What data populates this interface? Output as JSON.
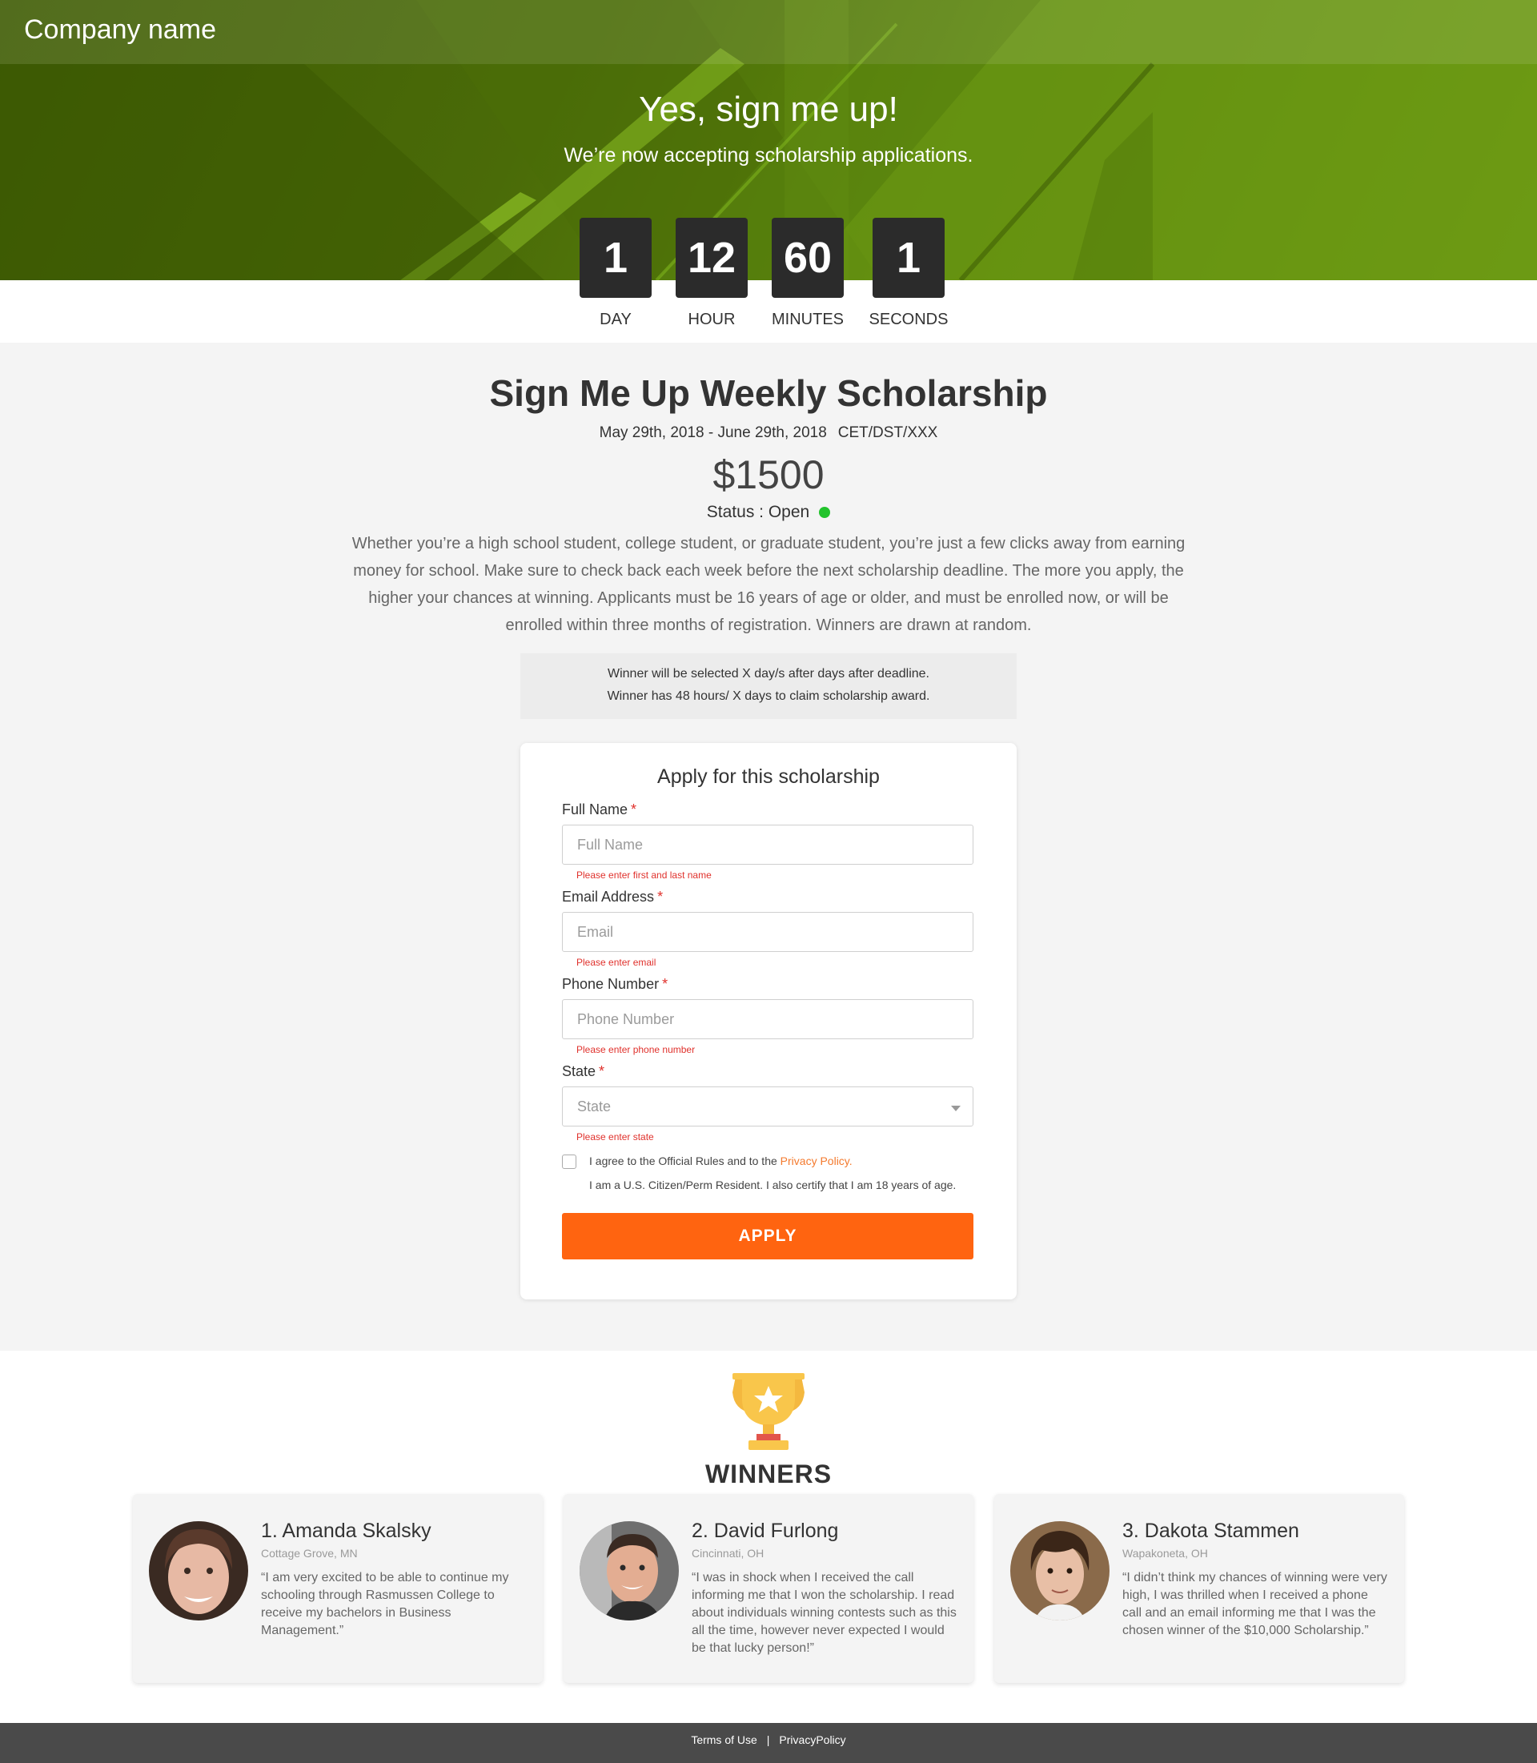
{
  "header": {
    "company_name": "Company name",
    "title": "Yes, sign me up!",
    "subtitle": "We’re now accepting scholarship applications."
  },
  "countdown": [
    {
      "value": "1",
      "label": "DAY"
    },
    {
      "value": "12",
      "label": "HOUR"
    },
    {
      "value": "60",
      "label": "MINUTES"
    },
    {
      "value": "1",
      "label": "SECONDS"
    }
  ],
  "scholarship": {
    "title": "Sign Me Up Weekly Scholarship",
    "dates": "May 29th, 2018 - June 29th, 2018",
    "timezone": "CET/DST/XXX",
    "amount": "$1500",
    "status": "Status : Open",
    "status_color": "#22c32c",
    "description": "Whether you’re a high school student, college student, or graduate student, you’re just a few clicks away from earning money for school. Make sure to check back each week before the next scholarship deadline. The more you apply, the higher your chances at winning. Applicants must be 16 years of age or older, and must be enrolled now, or will be enrolled within three months of registration. Winners are drawn at random.",
    "note_line1": "Winner will be selected X day/s after days after deadline.",
    "note_line2": "Winner has 48 hours/ X days to claim scholarship award."
  },
  "form": {
    "title": "Apply for this scholarship",
    "required_mark": "*",
    "full_name": {
      "label": "Full Name",
      "placeholder": "Full Name",
      "error": "Please enter first and last name"
    },
    "email": {
      "label": "Email Address",
      "placeholder": "Email",
      "error": "Please enter email"
    },
    "phone": {
      "label": "Phone Number",
      "placeholder": "Phone Number",
      "error": "Please enter phone number"
    },
    "state": {
      "label": "State",
      "placeholder": "State",
      "error": "Please enter state"
    },
    "agree_text": "I agree to the Official Rules and to the",
    "privacy_link": "Privacy Policy.",
    "certify_text": "I am a U.S. Citizen/Perm Resident.  I also certify that I am 18 years of age.",
    "apply_label": "APPLY",
    "accent_color": "#ff6410"
  },
  "winners": {
    "title": "WINNERS",
    "items": [
      {
        "name": "1. Amanda Skalsky",
        "location": "Cottage Grove, MN",
        "quote": "“I am very excited to be able to continue my schooling through Rasmussen College to receive my bachelors in Business Management.”"
      },
      {
        "name": "2. David Furlong",
        "location": "Cincinnati, OH",
        "quote": "“I was in shock when I received the call informing me that I won the scholarship. I read about individuals winning contests such as this all the time, however never expected I would be that lucky person!”"
      },
      {
        "name": "3. Dakota Stammen",
        "location": "Wapakoneta, OH",
        "quote": "“I didn’t think my chances of winning were very high, I was thrilled when I received a phone call and an email informing me that I was the chosen winner of the $10,000 Scholarship.”"
      }
    ]
  },
  "footer": {
    "terms": "Terms of Use",
    "separator": "|",
    "privacy": "PrivacyPolicy"
  }
}
